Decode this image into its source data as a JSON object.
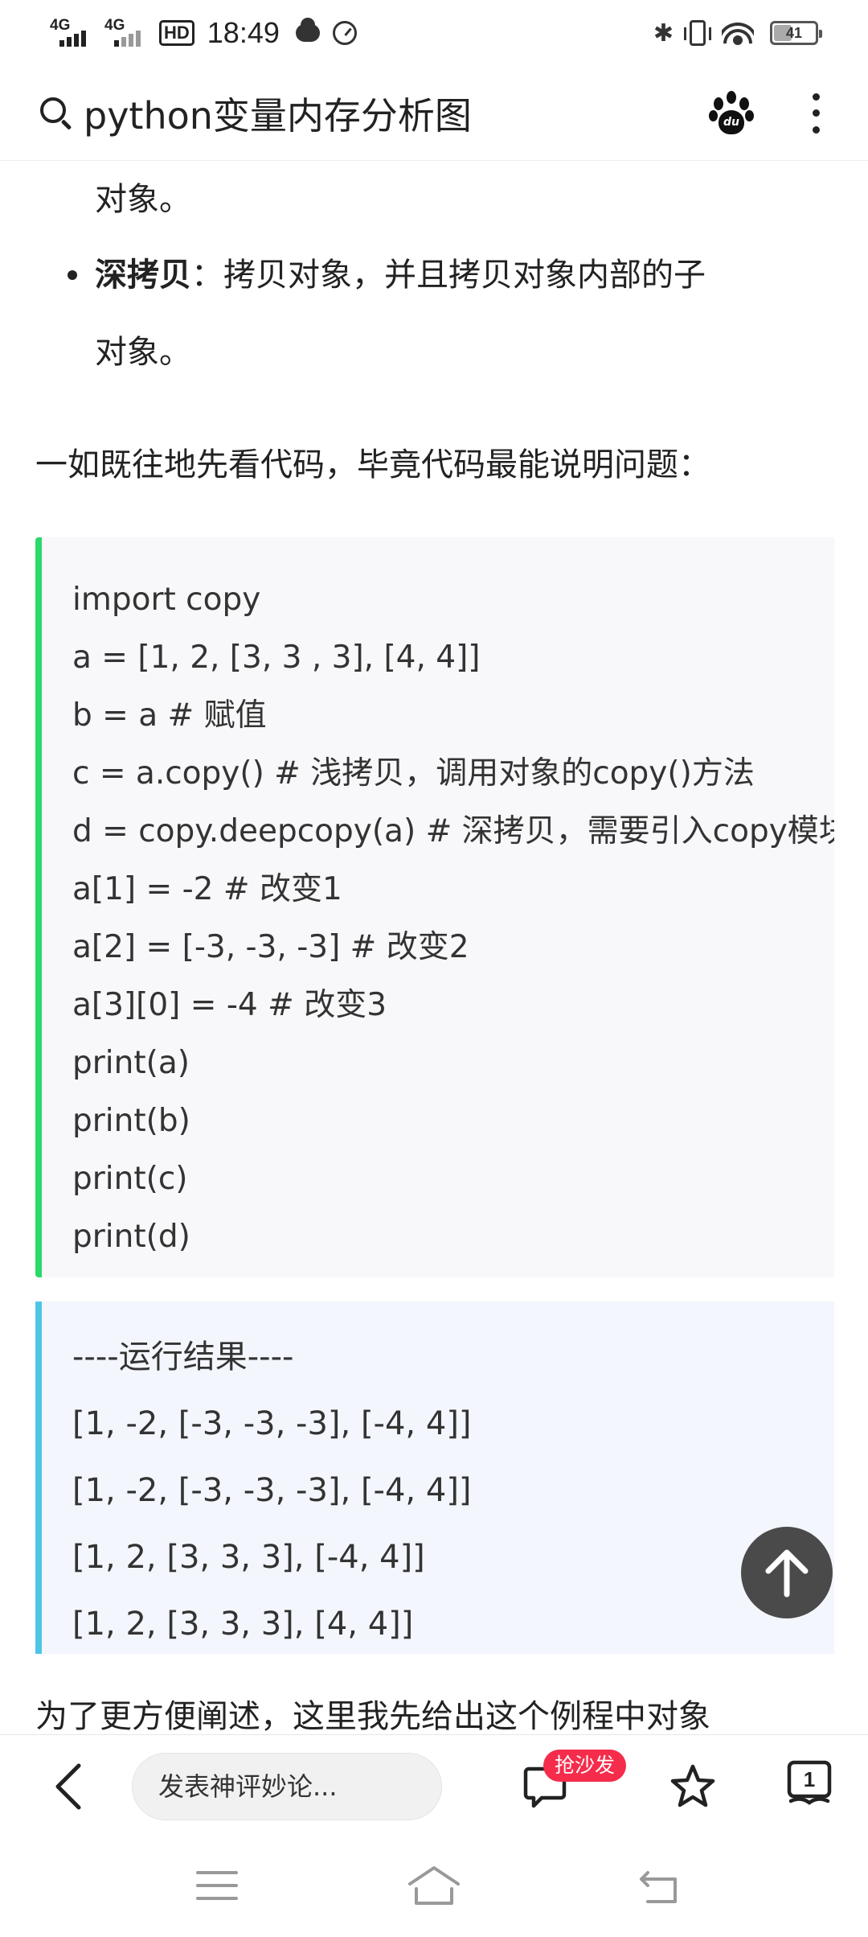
{
  "status_bar": {
    "network_1": "4G",
    "network_2": "4G",
    "hd_label": "HD",
    "time": "18:49",
    "battery": "41"
  },
  "header": {
    "search_query": "python变量内存分析图"
  },
  "article": {
    "cont_line": "对象。",
    "bullet": {
      "term": "深拷贝",
      "text": "：拷贝对象，并且拷贝对象内部的子",
      "wrap": "对象。"
    },
    "intro": "一如既往地先看代码，毕竟代码最能说明问题：",
    "code_lines": [
      "import copy",
      "a = [1, 2, [3, 3 , 3], [4, 4]]",
      "b = a # 赋值",
      "c = a.copy() # 浅拷贝，调用对象的copy()方法",
      "d = copy.deepcopy(a) # 深拷贝，需要引入copy模块",
      "a[1] = -2  # 改变1",
      "a[2] = [-3, -3, -3]  # 改变2",
      "a[3][0] = -4  # 改变3",
      "print(a)",
      "print(b)",
      "print(c)",
      "print(d)"
    ],
    "result_lines": [
      "----运行结果----",
      "[1, -2, [-3, -3, -3], [-4, 4]]",
      "[1, -2, [-3, -3, -3], [-4, 4]]",
      "[1, 2, [3, 3, 3], [-4, 4]]",
      "[1, 2, [3, 3, 3], [4, 4]]"
    ],
    "next_para": "为了更方便阐述，这里我先给出这个例程中对象"
  },
  "bottom_bar": {
    "comment_placeholder": "发表神评妙论...",
    "sofa_badge": "抢沙发",
    "reader_count": "1"
  },
  "colors": {
    "code_accent": "#2bd86a",
    "result_accent": "#4ec5e6",
    "badge": "#f52c4b"
  }
}
